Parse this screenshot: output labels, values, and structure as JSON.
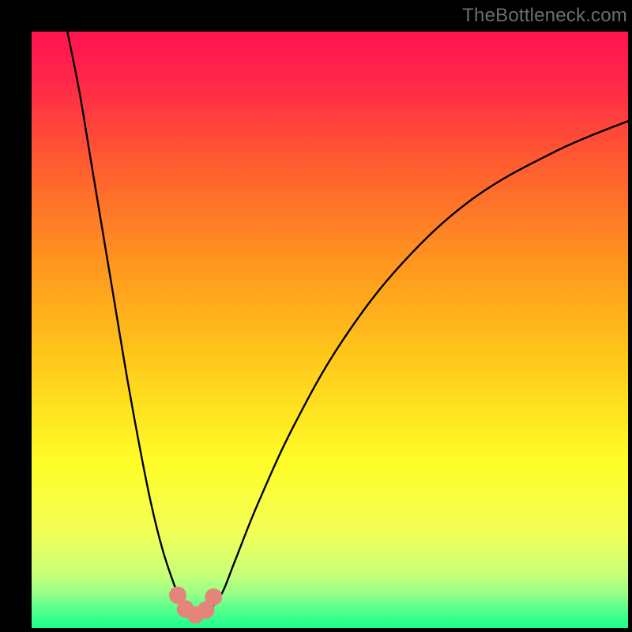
{
  "watermark": "TheBottleneck.com",
  "colors": {
    "frame": "#000000",
    "watermark": "#6e6e6e",
    "curve": "#000000",
    "marker_fill": "#e4847a",
    "marker_stroke": "#b85c54",
    "gradient_stops": [
      {
        "stop": 0.0,
        "color": "#ff1450"
      },
      {
        "stop": 0.08,
        "color": "#ff2649"
      },
      {
        "stop": 0.22,
        "color": "#ff5c30"
      },
      {
        "stop": 0.38,
        "color": "#ff931f"
      },
      {
        "stop": 0.55,
        "color": "#ffc91a"
      },
      {
        "stop": 0.72,
        "color": "#fffd27"
      },
      {
        "stop": 0.84,
        "color": "#f2ff58"
      },
      {
        "stop": 0.905,
        "color": "#ccff77"
      },
      {
        "stop": 0.94,
        "color": "#9cff86"
      },
      {
        "stop": 0.965,
        "color": "#5eff8c"
      },
      {
        "stop": 1.0,
        "color": "#1aff8c"
      }
    ]
  },
  "chart_data": {
    "type": "line",
    "title": "",
    "xlabel": "",
    "ylabel": "",
    "xlim": [
      0,
      100
    ],
    "ylim": [
      0,
      100
    ],
    "grid": false,
    "series": [
      {
        "name": "bottleneck-curve",
        "x": [
          6,
          8,
          10,
          12,
          14,
          16,
          18,
          20,
          22,
          24,
          25,
          26,
          27,
          28,
          29,
          30,
          32,
          34,
          38,
          44,
          52,
          62,
          74,
          88,
          100
        ],
        "y": [
          100,
          90,
          78,
          66,
          54,
          42,
          31,
          21,
          13,
          7,
          4.5,
          3,
          2.2,
          2,
          2.3,
          3.2,
          6,
          11,
          21,
          34,
          48,
          61,
          72,
          80,
          85
        ]
      }
    ],
    "markers": [
      {
        "x": 24.5,
        "y": 5.5
      },
      {
        "x": 25.8,
        "y": 3.2
      },
      {
        "x": 27.5,
        "y": 2.2
      },
      {
        "x": 29.2,
        "y": 3.0
      },
      {
        "x": 30.5,
        "y": 5.2
      }
    ],
    "annotations": []
  }
}
